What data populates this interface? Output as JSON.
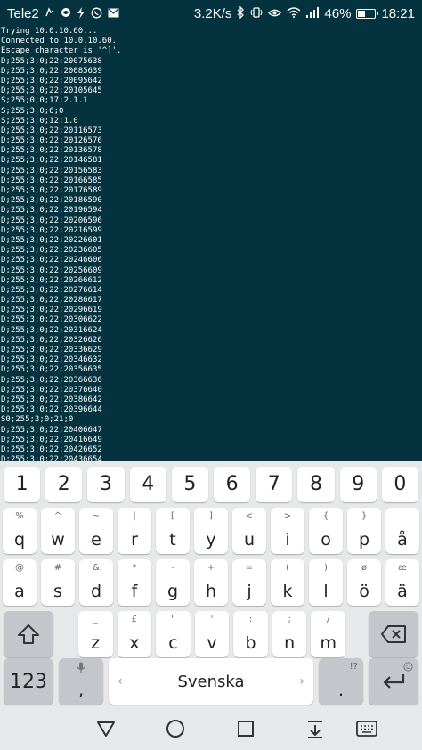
{
  "status_bar": {
    "carrier": "Tele2",
    "net_speed": "3.2K/s",
    "battery": "46%",
    "battery_level": 0.46,
    "time": "18:21",
    "left_icons": [
      "sim-activity-icon",
      "swirl-icon",
      "flash-icon",
      "whatsapp-icon",
      "mail-icon"
    ],
    "right_icons": [
      "bluetooth-icon",
      "vibrate-icon",
      "eye-icon",
      "wifi-icon",
      "signal-icon"
    ]
  },
  "terminal": {
    "lines": [
      "Trying 10.0.10.60...",
      "Connected to 10.0.10.60.",
      "Escape character is '^]'.",
      "D;255;3;0;22;20075638",
      "D;255;3;0;22;20085639",
      "D;255;3;0;22;20095642",
      "D;255;3;0;22;20105645",
      "S;255;0;0;17;2.1.1",
      "S;255;3;0;6;0",
      "S;255;3;0;12;1.0",
      "D;255;3;0;22;20116573",
      "D;255;3;0;22;20126576",
      "D;255;3;0;22;20136578",
      "D;255;3;0;22;20146581",
      "D;255;3;0;22;20156583",
      "D;255;3;0;22;20166585",
      "D;255;3;0;22;20176589",
      "D;255;3;0;22;20186590",
      "D;255;3;0;22;20196594",
      "D;255;3;0;22;20206596",
      "D;255;3;0;22;20216599",
      "D;255;3;0;22;20226601",
      "D;255;3;0;22;20236605",
      "D;255;3;0;22;20246606",
      "D;255;3;0;22;20256609",
      "D;255;3;0;22;20266612",
      "D;255;3;0;22;20276614",
      "D;255;3;0;22;20286617",
      "D;255;3;0;22;20296619",
      "D;255;3;0;22;20306622",
      "D;255;3;0;22;20316624",
      "D;255;3;0;22;20326626",
      "D;255;3;0;22;20336629",
      "D;255;3;0;22;20346632",
      "D;255;3;0;22;20356635",
      "D;255;3;0;22;20366636",
      "D;255;3;0;22;20376640",
      "D;255;3;0;22;20386642",
      "D;255;3;0;22;20396644",
      "S0;255;3;0;21;0",
      "D;255;3;0;22;20406647",
      "D;255;3;0;22;20416649",
      "D;255;3;0;22;20426652",
      "D;255;3;0;22;20436654"
    ]
  },
  "keyboard": {
    "number_row": [
      "1",
      "2",
      "3",
      "4",
      "5",
      "6",
      "7",
      "8",
      "9",
      "0"
    ],
    "row1": [
      {
        "main": "q",
        "alt": "%"
      },
      {
        "main": "w",
        "alt": "^"
      },
      {
        "main": "e",
        "alt": "~"
      },
      {
        "main": "r",
        "alt": "|"
      },
      {
        "main": "t",
        "alt": "["
      },
      {
        "main": "y",
        "alt": "]"
      },
      {
        "main": "u",
        "alt": "<"
      },
      {
        "main": "i",
        "alt": ">"
      },
      {
        "main": "o",
        "alt": "{"
      },
      {
        "main": "p",
        "alt": "}"
      },
      {
        "main": "å",
        "alt": ""
      }
    ],
    "row2": [
      {
        "main": "a",
        "alt": "@"
      },
      {
        "main": "s",
        "alt": "#"
      },
      {
        "main": "d",
        "alt": "&"
      },
      {
        "main": "f",
        "alt": "*"
      },
      {
        "main": "g",
        "alt": "-"
      },
      {
        "main": "h",
        "alt": "+"
      },
      {
        "main": "j",
        "alt": "="
      },
      {
        "main": "k",
        "alt": "("
      },
      {
        "main": "l",
        "alt": ")"
      },
      {
        "main": "ö",
        "alt": "ø"
      },
      {
        "main": "ä",
        "alt": "æ"
      }
    ],
    "row3": [
      {
        "main": "z",
        "alt": "_"
      },
      {
        "main": "x",
        "alt": "£"
      },
      {
        "main": "c",
        "alt": "\""
      },
      {
        "main": "v",
        "alt": "'"
      },
      {
        "main": "b",
        "alt": ":"
      },
      {
        "main": "n",
        "alt": ";"
      },
      {
        "main": "m",
        "alt": "/"
      }
    ],
    "symbols_key": "123",
    "comma_key": ",",
    "space_label": "Svenska",
    "period_key": ".",
    "period_alt": "!?",
    "accent_color": "#04323f"
  },
  "nav_bar": {
    "icons": [
      "back-icon",
      "home-icon",
      "recents-icon",
      "notification-pull-icon",
      "keyboard-switch-icon"
    ]
  }
}
